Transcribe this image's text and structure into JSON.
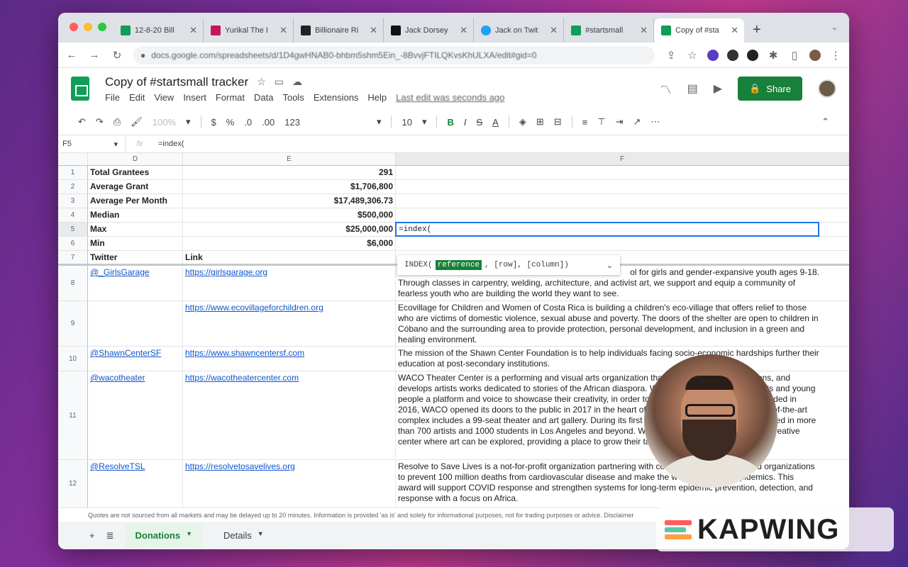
{
  "colors": {
    "sheets_green": "#188038",
    "link": "#1155cc",
    "active_cell": "#1a73e8"
  },
  "tabs": [
    {
      "title": "12-8-20 Bill",
      "favicon_color": "#0f9d58"
    },
    {
      "title": "Yurikal The I",
      "favicon_color": "#c2185b"
    },
    {
      "title": "Billionaire Ri",
      "favicon_color": "#222222"
    },
    {
      "title": "Jack Dorsey",
      "favicon_color": "#111111"
    },
    {
      "title": "Jack on Twit",
      "favicon_color": "#1da1f2"
    },
    {
      "title": "#startsmall",
      "favicon_color": "#0f9d58"
    },
    {
      "title": "Copy of #sta",
      "favicon_color": "#0f9d58"
    }
  ],
  "address": {
    "url": "docs.google.com/spreadsheets/d/1D4gwHNAB0-bhbm5shm5Ein_-8BvvjFTILQKvsKhULXA/edit#gid=0"
  },
  "doc": {
    "title": "Copy of #startsmall tracker",
    "menus": [
      "File",
      "Edit",
      "View",
      "Insert",
      "Format",
      "Data",
      "Tools",
      "Extensions",
      "Help"
    ],
    "last_edit": "Last edit was seconds ago",
    "share_label": "Share"
  },
  "format_toolbar": {
    "zoom": "100%",
    "currency": "$",
    "percent": "%",
    "dec_less": ".0",
    "dec_more": ".00",
    "num_format": "123",
    "font_size": "10",
    "bold": "B",
    "italic": "I",
    "strike": "S",
    "text_color": "A"
  },
  "formula_bar": {
    "cell_ref": "F5",
    "formula": "=index("
  },
  "columns": [
    "D",
    "E",
    "F"
  ],
  "summary_rows": [
    {
      "row": "1",
      "label": "Total Grantees",
      "value": "291"
    },
    {
      "row": "2",
      "label": "Average Grant",
      "value": "$1,706,800"
    },
    {
      "row": "3",
      "label": "Average Per Month",
      "value": "$17,489,306.73"
    },
    {
      "row": "4",
      "label": "Median",
      "value": "$500,000"
    },
    {
      "row": "5",
      "label": "Max",
      "value": "$25,000,000",
      "f": "=index("
    },
    {
      "row": "6",
      "label": "Min",
      "value": "$6,000"
    },
    {
      "row": "7",
      "label": "Twitter",
      "value": "Link"
    }
  ],
  "tooltip": {
    "fn": "INDEX(",
    "arg1": "reference",
    "rest": ", [row], [column])"
  },
  "data_rows": [
    {
      "row": "8",
      "twitter": "@_GirlsGarage",
      "link": "https://girlsgarage.org",
      "desc": "Through classes in carpentry, welding, architecture, and activist art, we support and equip a community of fearless youth who are building the world they want to see.",
      "desc_lead": "ol for girls and gender-expansive youth ages 9-18."
    },
    {
      "row": "9",
      "twitter": "",
      "link": "https://www.ecovillageforchildren.org",
      "desc": "Ecovillage for Children and Women of Costa Rica is building a children's eco-village that offers relief to those who are victims of domestic violence, sexual abuse and poverty. The doors of the shelter are open to children in Cóbano and the surrounding area to provide protection, personal development, and inclusion in a green and healing environment."
    },
    {
      "row": "10",
      "twitter": "@ShawnCenterSF",
      "link": "https://www.shawncentersf.com",
      "desc": "The mission of the Shawn Center Foundation is to help individuals facing socio-economic hardships further their education at post-secondary institutions."
    },
    {
      "row": "11",
      "twitter": "@wacotheater",
      "link": "https://wacotheatercenter.com",
      "desc": "WACO Theater Center is a performing and visual arts organization that creates original productions, and develops artists works dedicated to stories of the African diaspora. WACO provides emerging artists and young people a platform and voice to showcase their creativity, in order to strengthen the community. Founded in 2016, WACO opened its doors to the public in 2017 in the heart of the NoHo Arts District. The state-of-the-art complex includes a 99-seat theater and art gallery. During its first five-year history, WACO has invested in more than 700 artists and 1000 students in Los Angeles and beyond. WACO is committed to providing a creative center where art can be explored, providing a place to grow their talent and celebrate their artistry."
    },
    {
      "row": "12",
      "twitter": "@ResolveTSL",
      "link": "https://resolvetosavelives.org",
      "desc": "Resolve to Save Lives is a not-for-profit organization partnering with countries, communities, and organizations to prevent 100 million deaths from cardiovascular disease and make the world safer from epidemics. This award will support COVID response and strengthen systems for long-term epidemic prevention, detection, and response with a focus on Africa."
    }
  ],
  "notice": "Quotes are not sourced from all markets and may be delayed up to 20 minutes. Information is provided 'as is' and solely for informational purposes, not for trading purposes or advice. Disclaimer",
  "sheet_tabs": [
    "Donations",
    "Details"
  ],
  "watermark": "KAPWING"
}
